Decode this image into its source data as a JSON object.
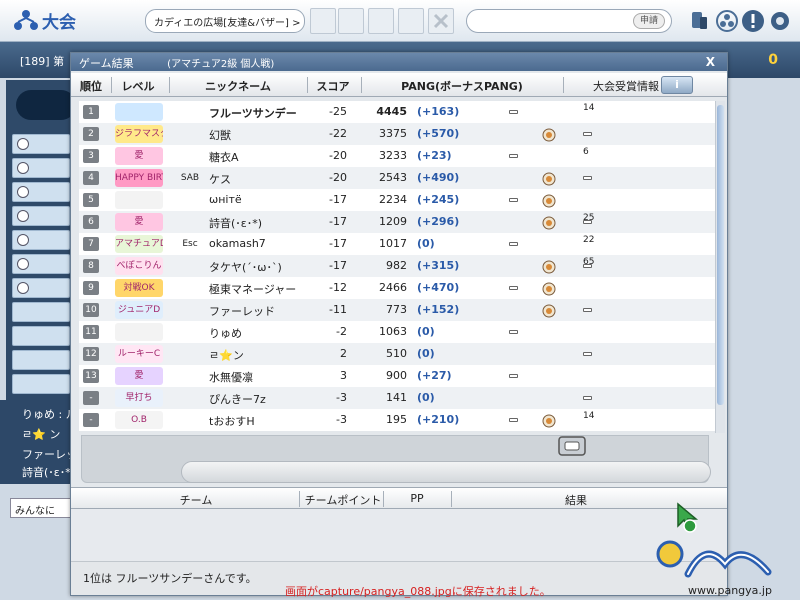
{
  "topbar": {
    "title": "大会",
    "breadcrumb": "カディエの広場[友達&バザー] > お友達募集",
    "apply_label": "申請"
  },
  "room_bar": {
    "room_prefix": "[189]",
    "room_name": "第",
    "score": "0"
  },
  "dialog": {
    "title": "ゲーム結果",
    "subtitle": "(アマチュア2級 個人戦)",
    "close": "X",
    "info_button": "i",
    "columns": {
      "rank": "順位",
      "level": "レベル",
      "nickname": "ニックネーム",
      "score": "スコア",
      "pang": "PANG(ボーナスPANG)",
      "award_info": "大会受賞情報"
    },
    "rows": [
      {
        "rank": "1",
        "level": "",
        "emblem": "",
        "nickname": "フルーツサンデー",
        "score": "-25",
        "pang": "4445",
        "bonus": "(+163)",
        "award": "14"
      },
      {
        "rank": "2",
        "level": "ジラフマスター",
        "emblem": "",
        "nickname": "幻獣",
        "score": "-22",
        "pang": "3375",
        "bonus": "(+570)",
        "award": ""
      },
      {
        "rank": "3",
        "level": "愛",
        "emblem": "",
        "nickname": "糖衣A",
        "score": "-20",
        "pang": "3233",
        "bonus": "(+23)",
        "award": "6"
      },
      {
        "rank": "4",
        "level": "HAPPY BIRTHDAY",
        "emblem": "SAB",
        "nickname": "ケス",
        "score": "-20",
        "pang": "2543",
        "bonus": "(+490)",
        "award": ""
      },
      {
        "rank": "5",
        "level": "",
        "emblem": "",
        "nickname": "ωнiтё",
        "score": "-17",
        "pang": "2234",
        "bonus": "(+245)",
        "award": ""
      },
      {
        "rank": "6",
        "level": "愛",
        "emblem": "",
        "nickname": "詩音(･ε･*)",
        "score": "-17",
        "pang": "1209",
        "bonus": "(+296)",
        "award": "25"
      },
      {
        "rank": "7",
        "level": "アマチュアD",
        "emblem": "Esc",
        "nickname": "okamash7",
        "score": "-17",
        "pang": "1017",
        "bonus": "(0)",
        "award": "22"
      },
      {
        "rank": "8",
        "level": "べぽこりん",
        "emblem": "",
        "nickname": "タケヤ(´･ω･`)",
        "score": "-17",
        "pang": "982",
        "bonus": "(+315)",
        "award": "65"
      },
      {
        "rank": "9",
        "level": "対戦OK",
        "emblem": "",
        "nickname": "極東マネージャー",
        "score": "-12",
        "pang": "2466",
        "bonus": "(+470)",
        "award": ""
      },
      {
        "rank": "10",
        "level": "ジュニアD",
        "emblem": "",
        "nickname": "ファーレッド",
        "score": "-11",
        "pang": "773",
        "bonus": "(+152)",
        "award": ""
      },
      {
        "rank": "11",
        "level": "",
        "emblem": "",
        "nickname": "りゅめ",
        "score": "-2",
        "pang": "1063",
        "bonus": "(0)",
        "award": ""
      },
      {
        "rank": "12",
        "level": "ルーキーC",
        "emblem": "",
        "nickname": "ㄹ⭐ン",
        "score": "2",
        "pang": "510",
        "bonus": "(0)",
        "award": ""
      },
      {
        "rank": "13",
        "level": "愛",
        "emblem": "",
        "nickname": "水無優凛",
        "score": "3",
        "pang": "900",
        "bonus": "(+27)",
        "award": ""
      },
      {
        "rank": "-",
        "level": "早打ち",
        "emblem": "",
        "nickname": "ぴんきー7z",
        "score": "-3",
        "pang": "141",
        "bonus": "(0)",
        "award": ""
      },
      {
        "rank": "-",
        "level": "O.B",
        "emblem": "",
        "nickname": "tおおすH",
        "score": "-3",
        "pang": "195",
        "bonus": "(+210)",
        "award": "14"
      }
    ],
    "team_columns": {
      "team": "チーム",
      "team_points": "チームポイント",
      "pp": "PP",
      "result": "結果"
    },
    "status_text": "1位は フルーツサンデーさんです。",
    "capture_message": "画面がcapture/pangya_088.jpgに保存されました。"
  },
  "left_panel": {
    "names": [
      "りゅめ : ルー",
      "ㄹ⭐ ン",
      "ファーレッド",
      "詩音(･ε･*)"
    ],
    "chat_placeholder": "みんなに"
  },
  "brand": {
    "url": "www.pangya.jp"
  },
  "colors": {
    "bonus": "#2a5aa8",
    "capture_message": "#d62020",
    "accent": "#2c5fb0"
  }
}
